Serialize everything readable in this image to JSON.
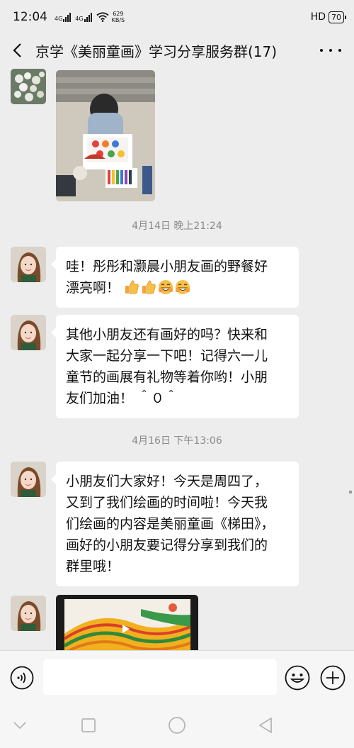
{
  "status_bar": {
    "time": "12:04",
    "signal_1": "4G",
    "signal_2": "4G",
    "net_speed_value": "629",
    "net_speed_unit": "KB/S",
    "hd_label": "HD",
    "battery": "70"
  },
  "header": {
    "title": "京学《美丽童画》学习分享服务群(17)"
  },
  "messages": {
    "ts1": "4月14日 晚上21:24",
    "m1": "哇！彤彤和灏晨小朋友画的野餐好漂亮啊！",
    "m1_line1": "哇！彤彤和灏晨小朋友画的野餐好",
    "m1_line2": "漂亮啊！",
    "m2_line1": "其他小朋友还有画好的吗？快来和",
    "m2_line2": "大家一起分享一下吧！记得六一儿",
    "m2_line3": "童节的画展有礼物等着你哟！小朋",
    "m2_line4": "友们加油！ ＾０＾",
    "ts2": "4月16日 下午13:06",
    "m3_line1": "小朋友们大家好！今天是周四了，",
    "m3_line2": "又到了我们绘画的时间啦！今天我",
    "m3_line3": "们绘画的内容是美丽童画《梯田》，",
    "m3_line4": "画好的小朋友要记得分享到我们的",
    "m3_line5": "群里哦！"
  },
  "emojis": [
    "thumbs-up",
    "thumbs-up",
    "grin",
    "grin"
  ],
  "input": {
    "placeholder": ""
  },
  "colors": {
    "chat_bg": "#ededed",
    "bubble": "#ffffff",
    "timestamp": "#8a8a8a"
  }
}
